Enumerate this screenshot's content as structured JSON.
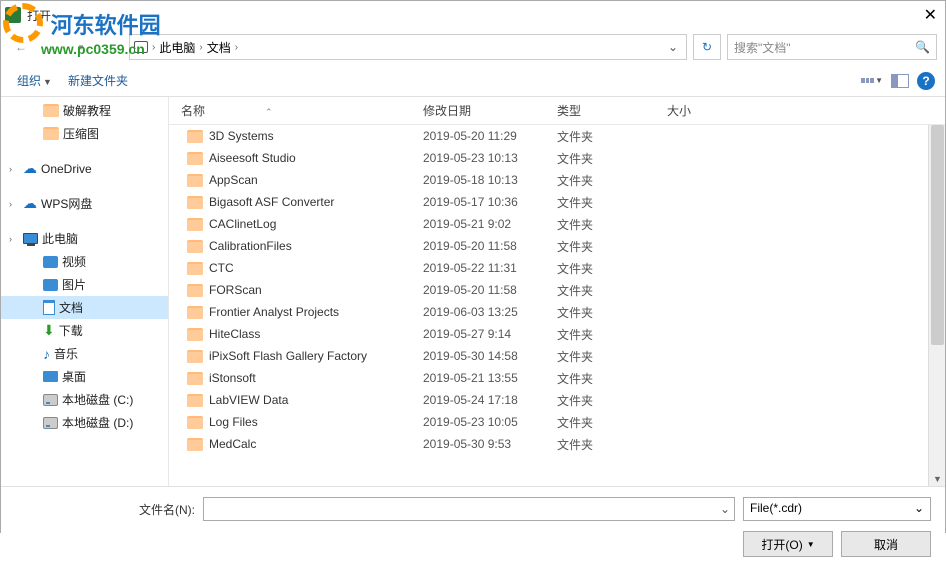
{
  "window": {
    "title": "打开"
  },
  "watermark": {
    "cn": "河东软件园",
    "url": "www.pc0359.cn"
  },
  "path": {
    "parts": [
      "此电脑",
      "文档"
    ]
  },
  "search": {
    "placeholder": "搜索\"文档\""
  },
  "toolbar": {
    "organize": "组织",
    "newfolder": "新建文件夹"
  },
  "sidebar": {
    "items": [
      {
        "label": "破解教程",
        "icon": "fold",
        "indent": 2
      },
      {
        "label": "压缩图",
        "icon": "fold",
        "indent": 2
      },
      {
        "label": "OneDrive",
        "icon": "cloud",
        "indent": 1,
        "exp": true
      },
      {
        "label": "WPS网盘",
        "icon": "cloud",
        "indent": 1,
        "exp": true
      },
      {
        "label": "此电脑",
        "icon": "pc",
        "indent": 1,
        "exp": true
      },
      {
        "label": "视频",
        "icon": "vid",
        "indent": 2
      },
      {
        "label": "图片",
        "icon": "img",
        "indent": 2
      },
      {
        "label": "文档",
        "icon": "doc",
        "indent": 2,
        "selected": true
      },
      {
        "label": "下载",
        "icon": "dl",
        "indent": 2
      },
      {
        "label": "音乐",
        "icon": "mus",
        "indent": 2
      },
      {
        "label": "桌面",
        "icon": "desk",
        "indent": 2
      },
      {
        "label": "本地磁盘 (C:)",
        "icon": "disk",
        "indent": 2
      },
      {
        "label": "本地磁盘 (D:)",
        "icon": "disk",
        "indent": 2
      }
    ]
  },
  "columns": {
    "name": "名称",
    "date": "修改日期",
    "type": "类型",
    "size": "大小"
  },
  "files": [
    {
      "name": "3D Systems",
      "date": "2019-05-20 11:29",
      "type": "文件夹"
    },
    {
      "name": "Aiseesoft Studio",
      "date": "2019-05-23 10:13",
      "type": "文件夹"
    },
    {
      "name": "AppScan",
      "date": "2019-05-18 10:13",
      "type": "文件夹"
    },
    {
      "name": "Bigasoft ASF Converter",
      "date": "2019-05-17 10:36",
      "type": "文件夹"
    },
    {
      "name": "CAClinetLog",
      "date": "2019-05-21 9:02",
      "type": "文件夹"
    },
    {
      "name": "CalibrationFiles",
      "date": "2019-05-20 11:58",
      "type": "文件夹"
    },
    {
      "name": "CTC",
      "date": "2019-05-22 11:31",
      "type": "文件夹"
    },
    {
      "name": "FORScan",
      "date": "2019-05-20 11:58",
      "type": "文件夹"
    },
    {
      "name": "Frontier Analyst Projects",
      "date": "2019-06-03 13:25",
      "type": "文件夹"
    },
    {
      "name": "HiteClass",
      "date": "2019-05-27 9:14",
      "type": "文件夹"
    },
    {
      "name": "iPixSoft Flash Gallery Factory",
      "date": "2019-05-30 14:58",
      "type": "文件夹"
    },
    {
      "name": "iStonsoft",
      "date": "2019-05-21 13:55",
      "type": "文件夹"
    },
    {
      "name": "LabVIEW Data",
      "date": "2019-05-24 17:18",
      "type": "文件夹"
    },
    {
      "name": "Log Files",
      "date": "2019-05-23 10:05",
      "type": "文件夹"
    },
    {
      "name": "MedCalc",
      "date": "2019-05-30 9:53",
      "type": "文件夹"
    }
  ],
  "bottom": {
    "filename_label": "文件名(N):",
    "filter": "File(*.cdr)",
    "open": "打开(O)",
    "cancel": "取消"
  }
}
